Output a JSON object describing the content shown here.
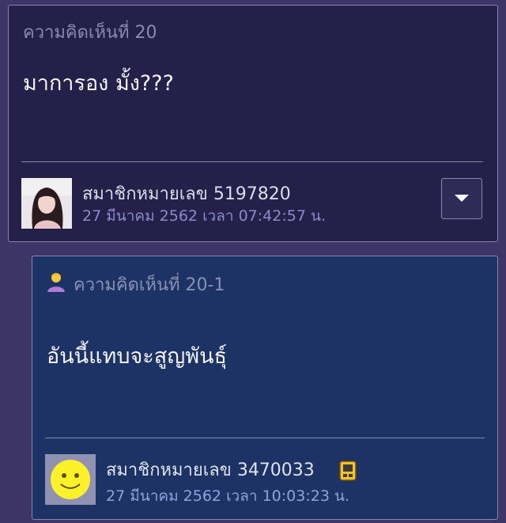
{
  "comment": {
    "number_label": "ความคิดเห็นที่ 20",
    "body": "มาการอง มั้ง???",
    "author": "สมาชิกหมายเลข 5197820",
    "timestamp": "27 มีนาคม 2562 เวลา 07:42:57 น.",
    "avatar_icon": "profile-photo",
    "menu_icon": "chevron-down-icon"
  },
  "reply": {
    "number_label": "ความคิดเห็นที่ 20-1",
    "body": "อันนี้แทบจะสูญพันธุ์",
    "author": "สมาชิกหมายเลข 3470033",
    "timestamp": "27 มีนาคม 2562 เวลา 10:03:23 น.",
    "avatar_icon": "smiley-icon",
    "header_icon": "person-icon",
    "badge_icon": "mobile-badge-icon"
  },
  "colors": {
    "page_bg": "#3d3566",
    "comment_bg": "#24204a",
    "reply_bg": "#1d3366",
    "timestamp": "#8a8bc8"
  }
}
